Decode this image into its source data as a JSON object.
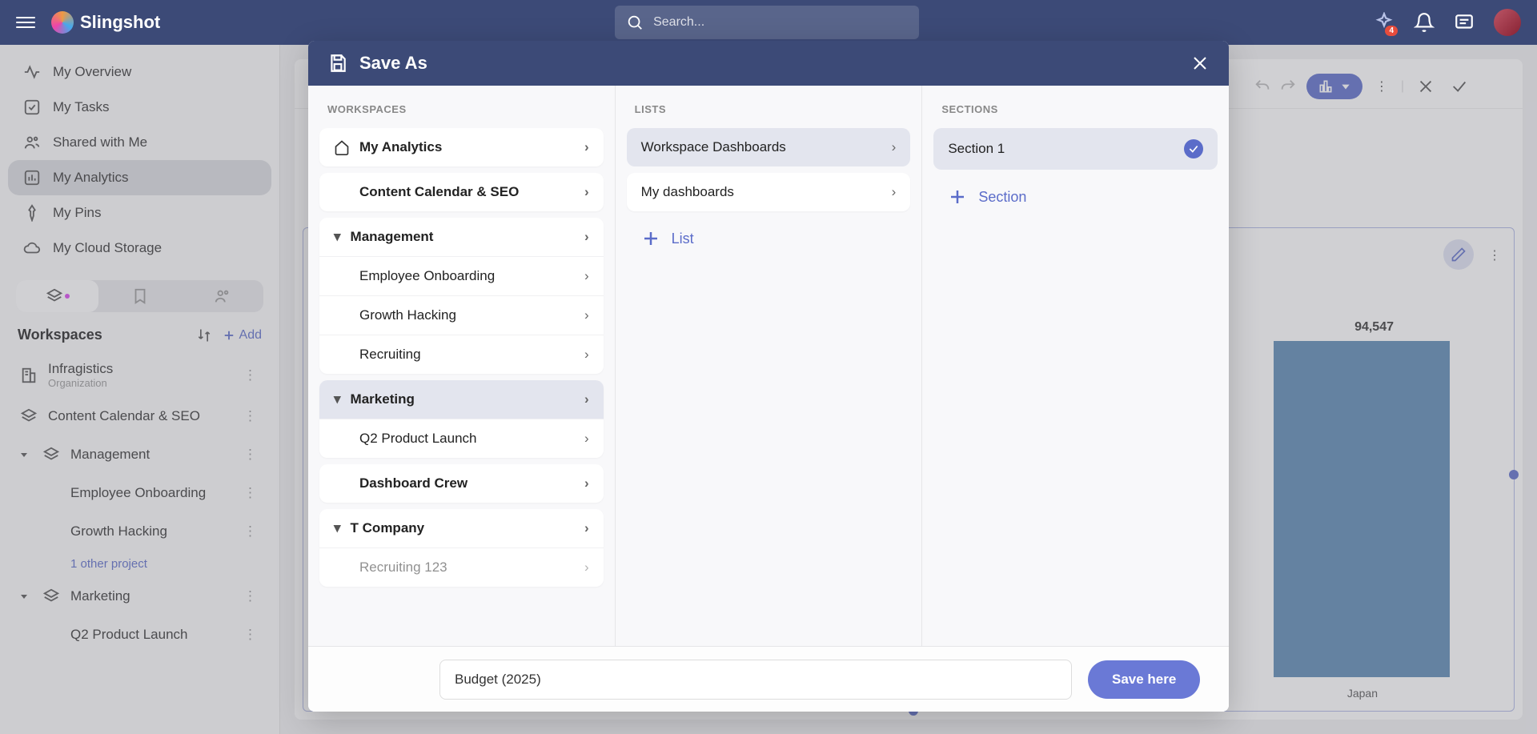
{
  "app": {
    "name": "Slingshot"
  },
  "search": {
    "placeholder": "Search..."
  },
  "notification_count": "4",
  "nav": {
    "overview": "My Overview",
    "tasks": "My Tasks",
    "shared": "Shared with Me",
    "analytics": "My Analytics",
    "pins": "My Pins",
    "cloud": "My Cloud Storage"
  },
  "sidebar": {
    "workspaces_title": "Workspaces",
    "add": "Add",
    "org": {
      "name": "Infragistics",
      "subtitle": "Organization"
    },
    "items": {
      "ccseo": "Content Calendar & SEO",
      "management": "Management",
      "emp_onboard": "Employee Onboarding",
      "growth": "Growth Hacking",
      "more": "1 other project",
      "marketing": "Marketing",
      "q2": "Q2 Product Launch"
    }
  },
  "modal": {
    "title": "Save As",
    "cols": {
      "workspaces": "WORKSPACES",
      "lists": "LISTS",
      "sections": "SECTIONS"
    },
    "workspaces": {
      "my_analytics": "My Analytics",
      "ccseo": "Content Calendar & SEO",
      "management": "Management",
      "emp_onboard": "Employee Onboarding",
      "growth": "Growth Hacking",
      "recruiting": "Recruiting",
      "marketing": "Marketing",
      "q2": "Q2 Product Launch",
      "dashboard_crew": "Dashboard Crew",
      "tcompany": "T Company",
      "recruiting123": "Recruiting 123"
    },
    "lists": {
      "wd": "Workspace Dashboards",
      "mydash": "My dashboards",
      "add": "List"
    },
    "sections": {
      "s1": "Section 1",
      "add": "Section"
    },
    "filename": "Budget (2025)",
    "save": "Save here"
  },
  "chart_data": {
    "type": "bar",
    "visible_bar": {
      "category": "Japan",
      "value": 94547,
      "label": "94,547"
    }
  }
}
